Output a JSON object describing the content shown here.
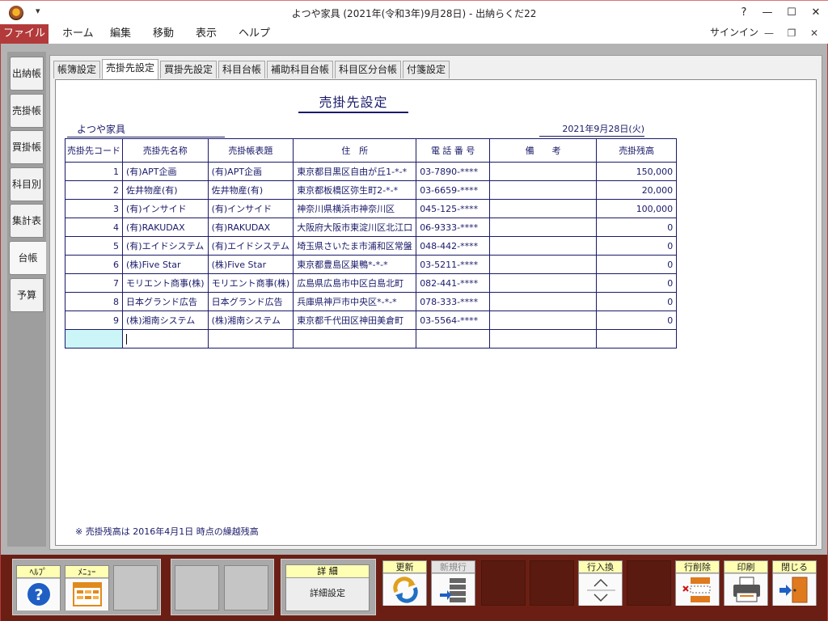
{
  "window": {
    "title": "よつや家具 (2021年(令和3年)9月28日) - 出納らくだ22",
    "help": "?",
    "minimize": "—",
    "maximize": "☐",
    "close": "✕"
  },
  "menu": {
    "file": "ファイル",
    "items": [
      "ホーム",
      "編集",
      "移動",
      "表示",
      "ヘルプ"
    ],
    "signin": "サインイン"
  },
  "sidebar": {
    "items": [
      {
        "label": "出納帳"
      },
      {
        "label": "売掛帳"
      },
      {
        "label": "買掛帳"
      },
      {
        "label": "科目別"
      },
      {
        "label": "集計表"
      },
      {
        "label": "台帳",
        "active": true
      },
      {
        "label": "予算"
      }
    ]
  },
  "tabs": [
    {
      "label": "帳簿設定"
    },
    {
      "label": "売掛先設定",
      "active": true
    },
    {
      "label": "買掛先設定"
    },
    {
      "label": "科目台帳"
    },
    {
      "label": "補助科目台帳"
    },
    {
      "label": "科目区分台帳"
    },
    {
      "label": "付箋設定"
    }
  ],
  "form": {
    "title": "売掛先設定",
    "company": "よつや家具",
    "date": "2021年9月28日(火)",
    "note": "※ 売掛残高は 2016年4月1日 時点の繰越残高"
  },
  "table": {
    "headers": [
      "売掛先コード",
      "売掛先名称",
      "売掛帳表題",
      "住　所",
      "電 話 番 号",
      "備　　考",
      "売掛残高"
    ],
    "rows": [
      [
        "1",
        "(有)APT企画",
        "(有)APT企画",
        "東京都目黒区自由が丘1-*-*",
        "03-7890-****",
        "",
        "150,000"
      ],
      [
        "2",
        "佐井物産(有)",
        "佐井物産(有)",
        "東京都板橋区弥生町2-*-*",
        "03-6659-****",
        "",
        "20,000"
      ],
      [
        "3",
        "(有)インサイド",
        "(有)インサイド",
        "神奈川県横浜市神奈川区",
        "045-125-****",
        "",
        "100,000"
      ],
      [
        "4",
        "(有)RAKUDAX",
        "(有)RAKUDAX",
        "大阪府大阪市東淀川区北江口",
        "06-9333-****",
        "",
        "0"
      ],
      [
        "5",
        "(有)エイドシステム",
        "(有)エイドシステム",
        "埼玉県さいたま市浦和区常盤",
        "048-442-****",
        "",
        "0"
      ],
      [
        "6",
        "(株)Five Star",
        "(株)Five Star",
        "東京都豊島区巣鴨*-*-*",
        "03-5211-****",
        "",
        "0"
      ],
      [
        "7",
        "モリエント商事(株)",
        "モリエント商事(株)",
        "広島県広島市中区白島北町",
        "082-441-****",
        "",
        "0"
      ],
      [
        "8",
        "日本グランド広告",
        "日本グランド広告",
        "兵庫県神戸市中央区*-*-*",
        "078-333-****",
        "",
        "0"
      ],
      [
        "9",
        "(株)湘南システム",
        "(株)湘南システム",
        "東京都千代田区神田美倉町",
        "03-5564-****",
        "",
        "0"
      ]
    ]
  },
  "toolbar": {
    "help": "ﾍﾙﾌﾟ",
    "menu": "ﾒﾆｭｰ",
    "detail": "詳 細",
    "detail_sub": "詳細設定",
    "update": "更新",
    "new_row": "新規行",
    "row_insert": "行入換",
    "row_delete": "行削除",
    "print": "印刷",
    "close": "閉じる"
  },
  "colors": {
    "accent": "#b33a3a",
    "toolbar_bg": "#6b1f14",
    "grid_ink": "#1a1a6a",
    "label_yellow": "#ffffb3"
  }
}
